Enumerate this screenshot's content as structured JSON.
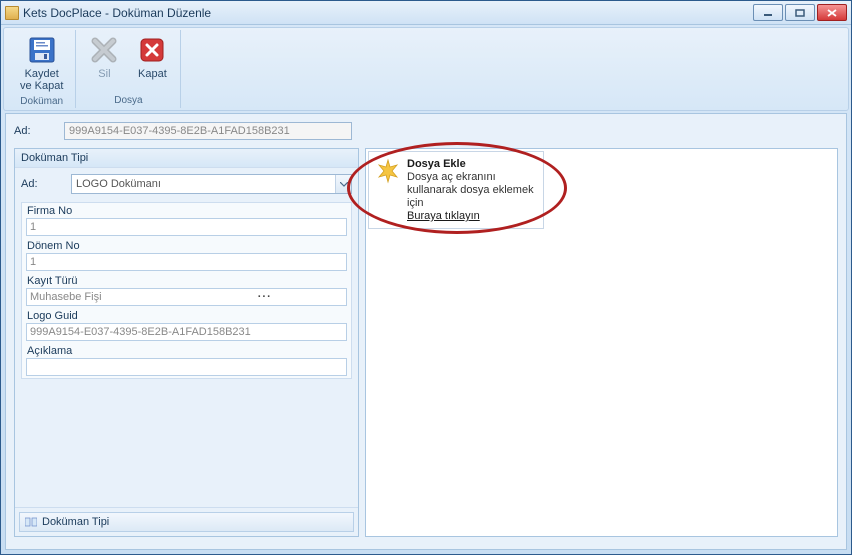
{
  "window": {
    "title": "Kets DocPlace - Doküman Düzenle"
  },
  "ribbon": {
    "groups": [
      {
        "title": "Doküman",
        "buttons": [
          {
            "label": "Kaydet\nve Kapat",
            "icon": "save"
          }
        ]
      },
      {
        "title": "Dosya",
        "buttons": [
          {
            "label": "Sil",
            "icon": "delete",
            "disabled": true
          },
          {
            "label": "Kapat",
            "icon": "close-red"
          }
        ]
      }
    ]
  },
  "top": {
    "ad_label": "Ad:",
    "ad_value": "999A9154-E037-4395-8E2B-A1FAD158B231"
  },
  "doctype": {
    "header": "Doküman Tipi",
    "ad_label": "Ad:",
    "combo_value": "LOGO Dokümanı",
    "props": {
      "firma_no_label": "Firma No",
      "firma_no_value": "1",
      "donem_no_label": "Dönem No",
      "donem_no_value": "1",
      "kayit_turu_label": "Kayıt Türü",
      "kayit_turu_value": "Muhasebe Fişi",
      "logo_guid_label": "Logo Guid",
      "logo_guid_value": "999A9154-E037-4395-8E2B-A1FAD158B231",
      "aciklama_label": "Açıklama",
      "aciklama_value": ""
    },
    "footer_btn": "Doküman Tipi"
  },
  "fileadd": {
    "title": "Dosya Ekle",
    "desc": "Dosya aç ekranını kullanarak dosya eklemek için",
    "link": "Buraya tıklayın"
  }
}
